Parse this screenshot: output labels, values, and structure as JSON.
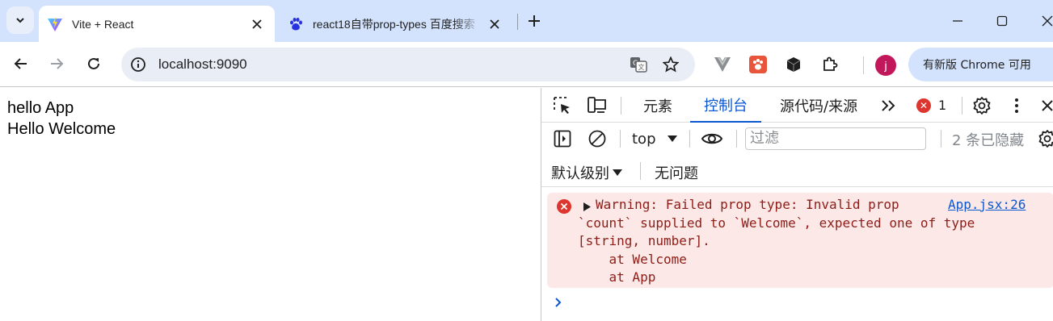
{
  "tabs": [
    {
      "title": "Vite + React",
      "active": true,
      "favicon": "vite-icon"
    },
    {
      "title": "react18自带prop-types  百度搜索",
      "active": false,
      "favicon": "baidu-paw-icon"
    }
  ],
  "toolbar": {
    "url": "localhost:9090",
    "avatar_letter": "j",
    "update_label": "有新版 Chrome 可用"
  },
  "page": {
    "lines": [
      "hello App",
      "Hello Welcome"
    ]
  },
  "devtools": {
    "tabs": [
      "元素",
      "控制台",
      "源代码/来源"
    ],
    "active_tab": "控制台",
    "error_count": "1",
    "context": "top",
    "filter_placeholder": "过滤",
    "hidden_count": "2 条已隐藏",
    "log_level": "默认级别",
    "issues": "无问题",
    "message": {
      "text": "Warning: Failed prop type: Invalid prop\n`count` supplied to `Welcome`, expected one of type\n[string, number].\n    at Welcome\n    at App",
      "source": "App.jsx:26"
    }
  },
  "colors": {
    "tabstrip": "#d3e3fd",
    "accent": "#0b57d0",
    "error_red": "#dc362e",
    "error_bg": "#fce8e6"
  }
}
